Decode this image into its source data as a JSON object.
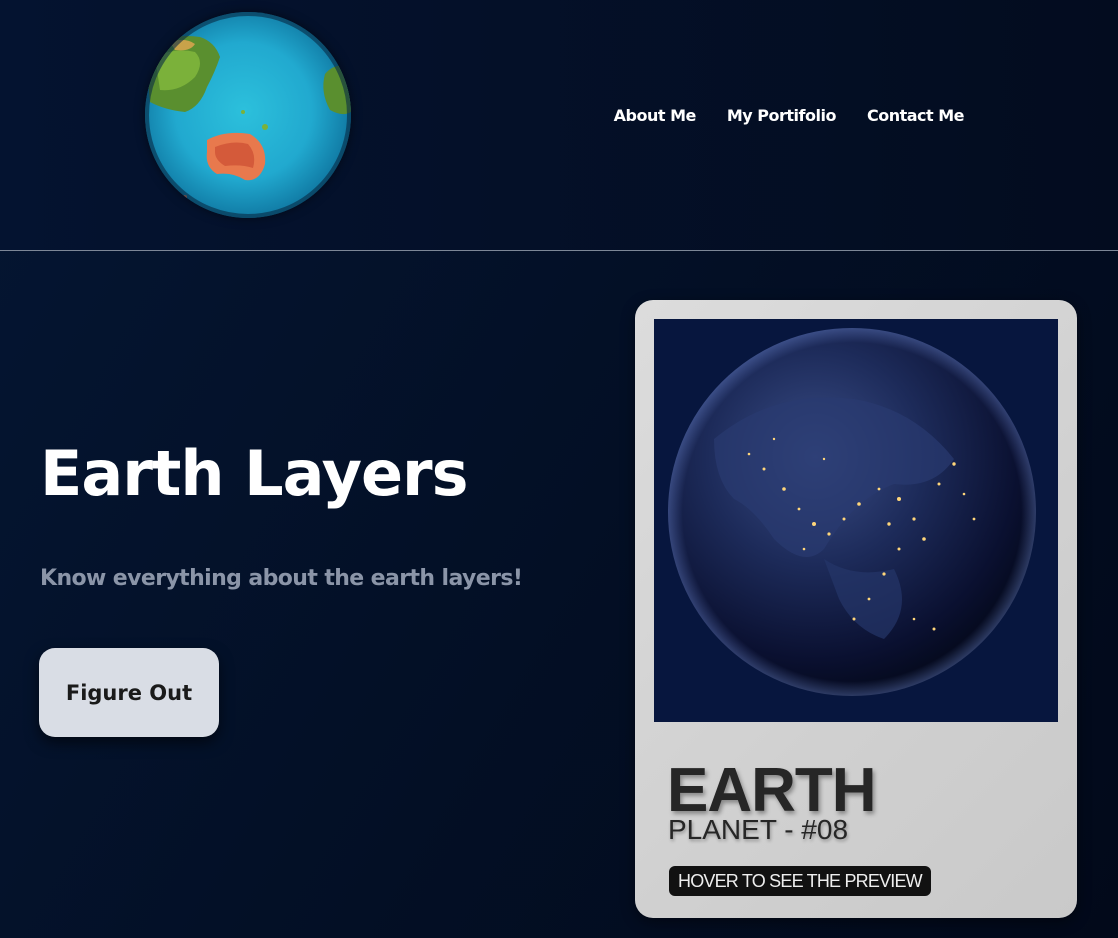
{
  "header": {
    "logo_icon": "globe-icon",
    "nav": [
      {
        "label": "About Me"
      },
      {
        "label": "My Portifolio"
      },
      {
        "label": "Contact Me"
      }
    ]
  },
  "hero": {
    "title": "Earth Layers",
    "subtitle": "Know everything about the earth layers!",
    "cta_label": "Figure Out"
  },
  "card": {
    "image_icon": "earth-night-image",
    "title": "EARTH",
    "subtitle": "PLANET - #08",
    "tag": "HOVER TO SEE THE PREVIEW"
  },
  "colors": {
    "background": "#031027",
    "nav_text": "#ffffff",
    "subtitle_text": "#8b95a8",
    "button_bg": "#d9dde5",
    "card_bg": "#d6d6d6",
    "tag_bg": "#111111"
  }
}
